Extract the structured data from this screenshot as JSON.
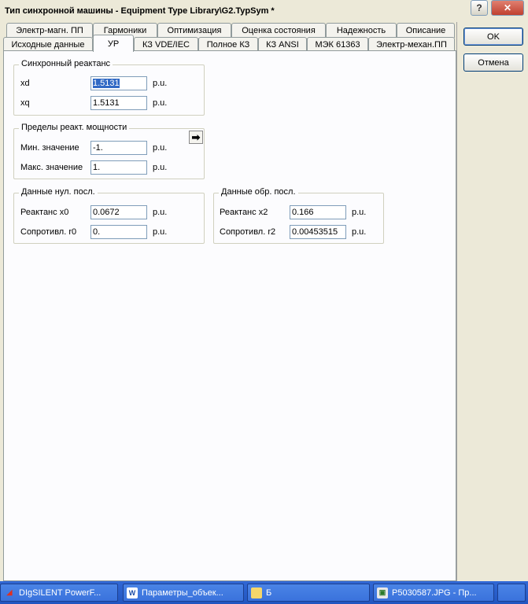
{
  "window": {
    "title": "Тип синхронной машины - Equipment Type Library\\G2.TypSym *",
    "help_label": "?",
    "close_label": "✕"
  },
  "tabs_row1": [
    {
      "label": "Электр-магн. ПП"
    },
    {
      "label": "Гармоники"
    },
    {
      "label": "Оптимизация"
    },
    {
      "label": "Оценка состояния"
    },
    {
      "label": "Надежность"
    },
    {
      "label": "Описание"
    }
  ],
  "tabs_row2": [
    {
      "label": "Исходные данные"
    },
    {
      "label": "УР"
    },
    {
      "label": "КЗ VDE/IEC"
    },
    {
      "label": "Полное КЗ"
    },
    {
      "label": "КЗ ANSI"
    },
    {
      "label": "МЭК 61363"
    },
    {
      "label": "Электр-механ.ПП"
    }
  ],
  "buttons": {
    "ok": "OK",
    "cancel": "Отмена"
  },
  "sync_reactance": {
    "title": "Синхронный реактанс",
    "xd": {
      "label": "xd",
      "value": "1.5131",
      "unit": "p.u."
    },
    "xq": {
      "label": "xq",
      "value": "1.5131",
      "unit": "p.u."
    }
  },
  "reactive_limits": {
    "title": "Пределы реакт. мощности",
    "min": {
      "label": "Мин. значение",
      "value": "-1.",
      "unit": "p.u."
    },
    "max": {
      "label": "Макс. значение",
      "value": "1.",
      "unit": "p.u."
    }
  },
  "zero_seq": {
    "title": "Данные нул. посл.",
    "x0": {
      "label": "Реактанс x0",
      "value": "0.0672",
      "unit": "p.u."
    },
    "r0": {
      "label": "Сопротивл. r0",
      "value": "0.",
      "unit": "p.u."
    }
  },
  "neg_seq": {
    "title": "Данные обр. посл.",
    "x2": {
      "label": "Реактанс x2",
      "value": "0.166",
      "unit": "p.u."
    },
    "r2": {
      "label": "Сопротивл. r2",
      "value": "0.00453515",
      "unit": "p.u."
    }
  },
  "taskbar": [
    {
      "label": "DIgSILENT PowerF...",
      "icon": "digsilent-icon"
    },
    {
      "label": "Параметры_объек...",
      "icon": "word-icon"
    },
    {
      "label": "Б",
      "icon": "folder-icon"
    },
    {
      "label": "P5030587.JPG - Пр...",
      "icon": "image-viewer-icon"
    }
  ]
}
